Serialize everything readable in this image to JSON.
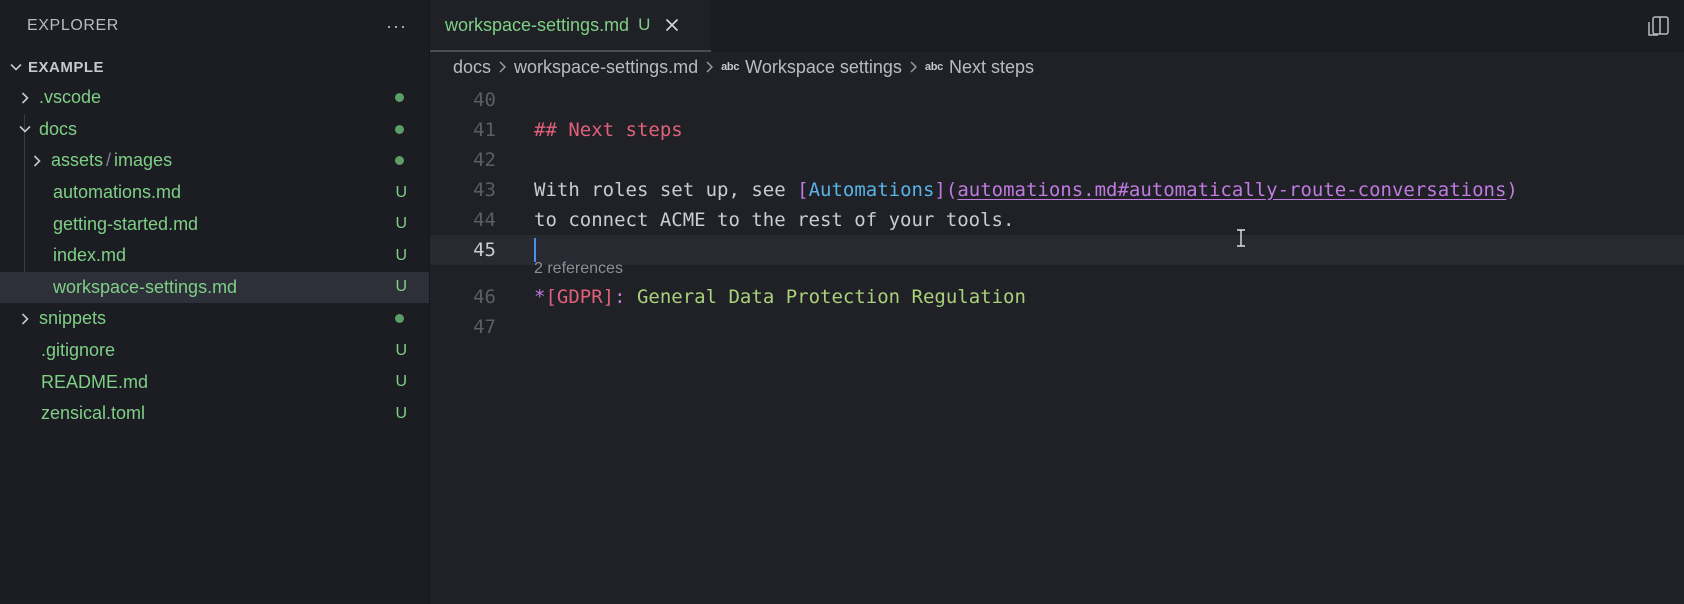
{
  "sidebar": {
    "title": "EXPLORER",
    "more_label": "···",
    "section": "EXAMPLE",
    "items": [
      {
        "label": ".vscode",
        "indent": 0,
        "type": "folder",
        "expanded": false,
        "status": "dot"
      },
      {
        "label": "docs",
        "indent": 0,
        "type": "folder",
        "expanded": true,
        "status": "dot"
      },
      {
        "label_parts": [
          "assets",
          "/",
          "images"
        ],
        "indent": 1,
        "type": "folder",
        "expanded": false,
        "status": "dot"
      },
      {
        "label": "automations.md",
        "indent": 1,
        "type": "file",
        "status": "U"
      },
      {
        "label": "getting-started.md",
        "indent": 1,
        "type": "file",
        "status": "U"
      },
      {
        "label": "index.md",
        "indent": 1,
        "type": "file",
        "status": "U"
      },
      {
        "label": "workspace-settings.md",
        "indent": 1,
        "type": "file",
        "status": "U",
        "selected": true
      },
      {
        "label": "snippets",
        "indent": 0,
        "type": "folder",
        "expanded": false,
        "status": "dot"
      },
      {
        "label": ".gitignore",
        "indent": 0,
        "type": "file",
        "status": "U"
      },
      {
        "label": "README.md",
        "indent": 0,
        "type": "file",
        "status": "U"
      },
      {
        "label": "zensical.toml",
        "indent": 0,
        "type": "file",
        "status": "U"
      }
    ]
  },
  "tab": {
    "label": "workspace-settings.md",
    "status": "U"
  },
  "breadcrumb": {
    "folder": "docs",
    "file": "workspace-settings.md",
    "symbol_icon": "abc",
    "section1": "Workspace settings",
    "section2": "Next steps"
  },
  "editor": {
    "line_numbers": [
      "40",
      "41",
      "42",
      "43",
      "44",
      "45",
      "46",
      "47"
    ],
    "current_line": "45",
    "heading": "## Next steps",
    "l43_prefix": "With roles set up, see ",
    "l43_link_open": "[",
    "l43_link_text": "Automations",
    "l43_link_close": "]",
    "l43_paren_open": "(",
    "l43_url": "automations.md#automatically-route-conversations",
    "l43_paren_close": ")",
    "l44_text": "to connect ACME to the rest of your tools.",
    "references": "2 references",
    "l46_star": "*",
    "l46_abbr": "[GDPR]",
    "l46_colon": ":",
    "l46_text": " General Data Protection Regulation"
  },
  "colors": {
    "accent": "#4f8cf0",
    "git_untracked": "#7fcf87",
    "heading": "#e0607a",
    "link": "#59b3e8",
    "url": "#c07ae0"
  }
}
